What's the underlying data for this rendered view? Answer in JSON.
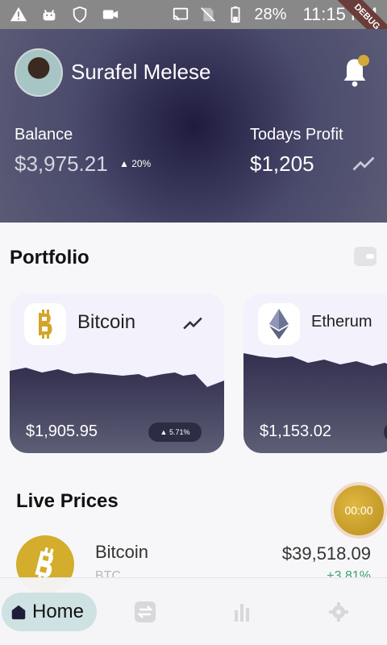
{
  "status_bar": {
    "battery": "28%",
    "time": "11:15 PM",
    "debug_label": "DEBUG"
  },
  "header": {
    "user_name": "Surafel Melese",
    "balance_label": "Balance",
    "balance_value": "$3,975.21",
    "balance_change": "▲ 20%",
    "profit_label": "Todays Profit",
    "profit_value": "$1,205"
  },
  "portfolio": {
    "title": "Portfolio",
    "cards": [
      {
        "name": "Bitcoin",
        "value": "$1,905.95",
        "change": "▲ 5.71%"
      },
      {
        "name": "Etherum",
        "value": "$1,153.02"
      }
    ]
  },
  "live_prices": {
    "title": "Live Prices",
    "timer": "00:00",
    "items": [
      {
        "name": "Bitcoin",
        "ticker": "BTC",
        "price": "$39,518.09",
        "change": "+3.81%"
      }
    ]
  },
  "nav": {
    "home_label": "Home"
  }
}
